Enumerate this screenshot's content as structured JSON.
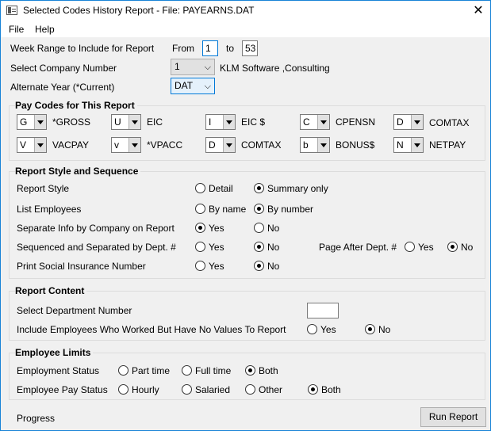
{
  "window": {
    "title": "Selected Codes History Report - File: PAYEARNS.DAT",
    "close_glyph": "✕"
  },
  "menu": {
    "file": "File",
    "help": "Help"
  },
  "week_range": {
    "label": "Week Range to Include for Report",
    "from_label": "From",
    "from_value": "1",
    "to_label": "to",
    "to_value": "53"
  },
  "company": {
    "label": "Select Company Number",
    "number": "1",
    "name": "KLM Software ,Consulting"
  },
  "alt_year": {
    "label": "Alternate Year (*Current)",
    "value": "DAT"
  },
  "pay_codes": {
    "title": "Pay Codes for This Report",
    "row1": [
      {
        "code": "G",
        "label": "*GROSS"
      },
      {
        "code": "U",
        "label": "EIC"
      },
      {
        "code": "I",
        "label": "EIC $"
      },
      {
        "code": "C",
        "label": "CPENSN"
      },
      {
        "code": "D",
        "label": "COMTAX"
      }
    ],
    "row2": [
      {
        "code": "V",
        "label": "VACPAY"
      },
      {
        "code": "v",
        "label": "*VPACC"
      },
      {
        "code": "D",
        "label": "COMTAX"
      },
      {
        "code": "b",
        "label": "BONUS$"
      },
      {
        "code": "N",
        "label": "NETPAY"
      }
    ]
  },
  "report_style": {
    "title": "Report Style and Sequence",
    "style_label": "Report Style",
    "detail": "Detail",
    "summary_only": "Summary only",
    "style_selected": "summary_only",
    "list_label": "List Employees",
    "by_name": "By name",
    "by_number": "By number",
    "list_selected": "by_number",
    "separate_label": "Separate Info by Company on Report",
    "separate_selected": "yes",
    "sequenced_label": "Sequenced and Separated by Dept. #",
    "sequenced_selected": "no",
    "page_after_label": "Page After Dept. #",
    "page_after_selected": "no",
    "sin_label": "Print Social Insurance Number",
    "sin_selected": "no",
    "yes": "Yes",
    "no": "No"
  },
  "report_content": {
    "title": "Report Content",
    "dept_label": "Select Department Number",
    "dept_value": "",
    "include_label": "Include Employees Who Worked But Have No Values To Report",
    "include_selected": "no",
    "yes": "Yes",
    "no": "No"
  },
  "employee_limits": {
    "title": "Employee Limits",
    "status_label": "Employment Status",
    "part_time": "Part time",
    "full_time": "Full time",
    "both": "Both",
    "status_selected": "both",
    "pay_label": "Employee Pay Status",
    "hourly": "Hourly",
    "salaried": "Salaried",
    "other": "Other",
    "pay_selected": "both"
  },
  "footer": {
    "progress_label": "Progress",
    "run_button": "Run Report"
  }
}
